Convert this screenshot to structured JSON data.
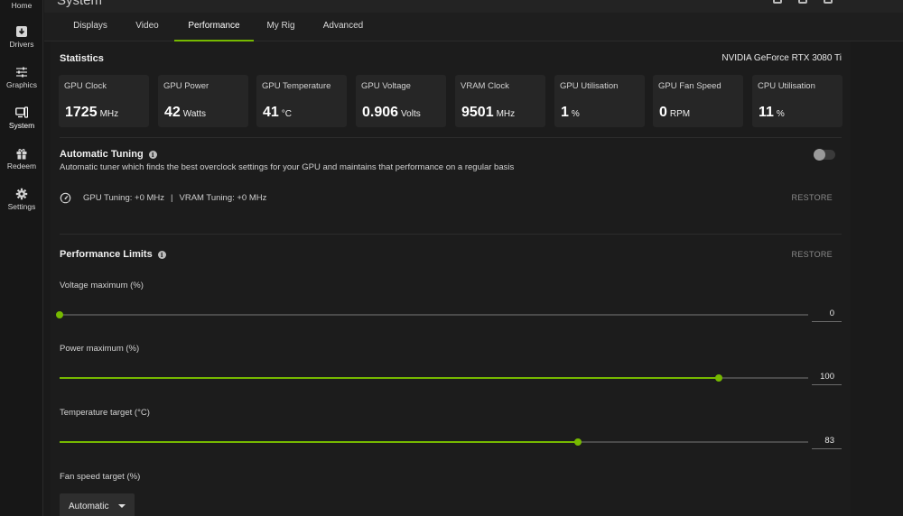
{
  "window": {
    "title": "System"
  },
  "sidebar": {
    "items": [
      {
        "label": "Home",
        "icon": "home-icon"
      },
      {
        "label": "Drivers",
        "icon": "drivers-icon"
      },
      {
        "label": "Graphics",
        "icon": "sliders-icon"
      },
      {
        "label": "System",
        "icon": "system-icon",
        "active": true
      },
      {
        "label": "Redeem",
        "icon": "gift-icon"
      },
      {
        "label": "Settings",
        "icon": "gear-icon"
      }
    ]
  },
  "tabs": [
    {
      "label": "Displays"
    },
    {
      "label": "Video"
    },
    {
      "label": "Performance",
      "active": true
    },
    {
      "label": "My Rig"
    },
    {
      "label": "Advanced"
    }
  ],
  "statistics": {
    "title": "Statistics",
    "gpu_name": "NVIDIA GeForce RTX 3080 Ti",
    "cards": [
      {
        "label": "GPU Clock",
        "value": "1725",
        "unit": "MHz"
      },
      {
        "label": "GPU Power",
        "value": "42",
        "unit": "Watts"
      },
      {
        "label": "GPU Temperature",
        "value": "41",
        "unit": "°C"
      },
      {
        "label": "GPU Voltage",
        "value": "0.906",
        "unit": "Volts"
      },
      {
        "label": "VRAM Clock",
        "value": "9501",
        "unit": "MHz"
      },
      {
        "label": "GPU Utilisation",
        "value": "1",
        "unit": "%"
      },
      {
        "label": "GPU Fan Speed",
        "value": "0",
        "unit": "RPM"
      },
      {
        "label": "CPU Utilisation",
        "value": "11",
        "unit": "%"
      }
    ]
  },
  "auto_tuning": {
    "title": "Automatic Tuning",
    "description": "Automatic tuner which finds the best overclock settings for your GPU and maintains that performance on a regular basis",
    "enabled": false,
    "gpu_tuning": "GPU Tuning: +0 MHz",
    "separator": "|",
    "vram_tuning": "VRAM Tuning: +0 MHz",
    "restore_label": "RESTORE"
  },
  "performance_limits": {
    "title": "Performance Limits",
    "restore_label": "RESTORE",
    "sliders": [
      {
        "label": "Voltage maximum (%)",
        "value": "0",
        "fraction": 0.0
      },
      {
        "label": "Power maximum (%)",
        "value": "100",
        "fraction": 0.88
      },
      {
        "label": "Temperature target (°C)",
        "value": "83",
        "fraction": 0.693
      }
    ],
    "fan_speed": {
      "label": "Fan speed target (%)",
      "selected": "Automatic"
    }
  },
  "colors": {
    "accent": "#76b900",
    "background": "#1a1a1a",
    "card": "#262626"
  }
}
